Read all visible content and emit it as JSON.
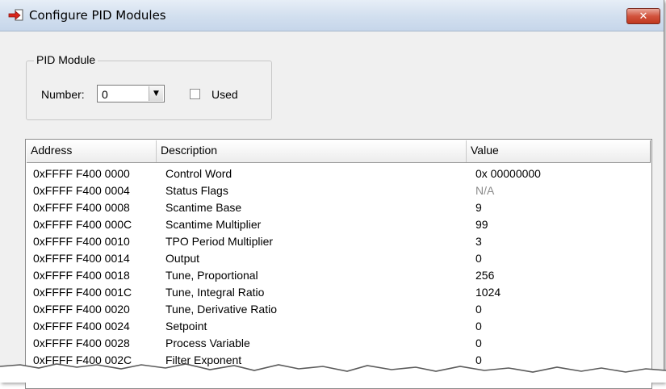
{
  "window": {
    "title": "Configure PID Modules",
    "close_glyph": "✕",
    "icon": "arrow-into-box-icon"
  },
  "pid_module": {
    "group_label": "PID Module",
    "number_label": "Number:",
    "number_value": "0",
    "used_label": "Used",
    "used_checked": false
  },
  "table": {
    "headers": [
      "Address",
      "Description",
      "Value"
    ],
    "rows": [
      {
        "address": "0xFFFF F400 0000",
        "description": "Control Word",
        "value": "0x 00000000"
      },
      {
        "address": "0xFFFF F400 0004",
        "description": "Status Flags",
        "value": "N/A"
      },
      {
        "address": "0xFFFF F400 0008",
        "description": "Scantime Base",
        "value": "9"
      },
      {
        "address": "0xFFFF F400 000C",
        "description": "Scantime Multiplier",
        "value": "99"
      },
      {
        "address": "0xFFFF F400 0010",
        "description": "TPO Period Multiplier",
        "value": "3"
      },
      {
        "address": "0xFFFF F400 0014",
        "description": "Output",
        "value": "0"
      },
      {
        "address": "0xFFFF F400 0018",
        "description": "Tune, Proportional",
        "value": "256"
      },
      {
        "address": "0xFFFF F400 001C",
        "description": "Tune, Integral Ratio",
        "value": "1024"
      },
      {
        "address": "0xFFFF F400 0020",
        "description": "Tune, Derivative Ratio",
        "value": "0"
      },
      {
        "address": "0xFFFF F400 0024",
        "description": "Setpoint",
        "value": "0"
      },
      {
        "address": "0xFFFF F400 0028",
        "description": "Process Variable",
        "value": "0"
      },
      {
        "address": "0xFFFF F400 002C",
        "description": "Filter Exponent",
        "value": "0"
      }
    ]
  },
  "colors": {
    "close_button": "#c8412a",
    "muted_value": "#8a8a8a"
  }
}
